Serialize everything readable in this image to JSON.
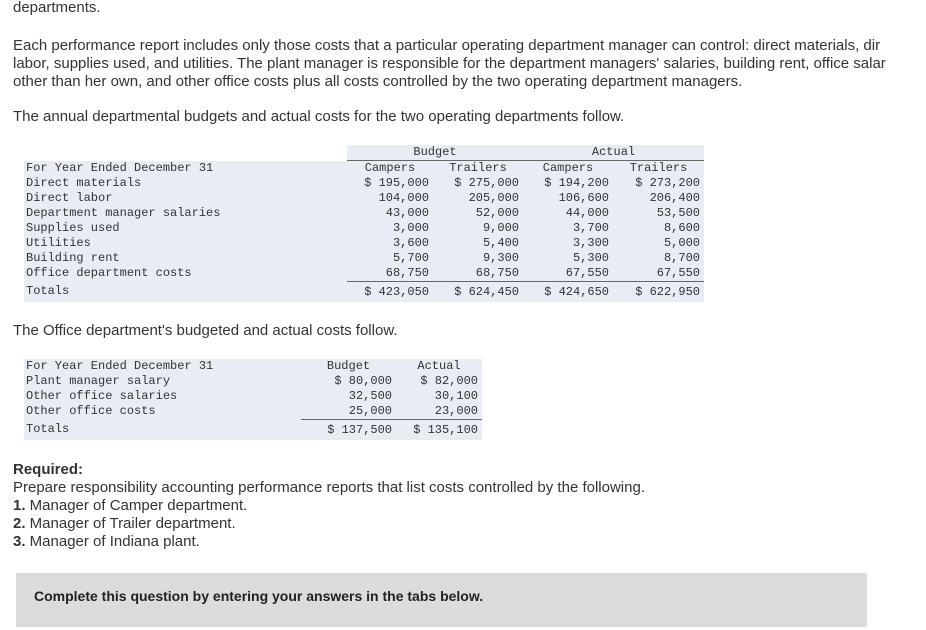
{
  "intro": {
    "line0": "departments.",
    "para1": [
      "Each performance report includes only those costs that a particular operating department manager can control: direct materials, dir",
      "labor, supplies used, and utilities. The plant manager is responsible for the department managers' salaries, building rent, office salar",
      "other than her own, and other office costs plus all costs controlled by the two operating department managers."
    ],
    "para2": "The annual departmental budgets and actual costs for the two operating departments follow."
  },
  "dept_table": {
    "group_budget": "Budget",
    "group_actual": "Actual",
    "row_header": "For Year Ended December 31",
    "columns": [
      "Campers",
      "Trailers",
      "Campers",
      "Trailers"
    ],
    "rows": [
      {
        "label": "Direct materials",
        "values": [
          "$ 195,000",
          "$ 275,000",
          "$ 194,200",
          "$ 273,200"
        ]
      },
      {
        "label": "Direct labor",
        "values": [
          "104,000",
          "205,000",
          "106,600",
          "206,400"
        ]
      },
      {
        "label": "Department manager salaries",
        "values": [
          "43,000",
          "52,000",
          "44,000",
          "53,500"
        ]
      },
      {
        "label": "Supplies used",
        "values": [
          "3,000",
          "9,000",
          "3,700",
          "8,600"
        ]
      },
      {
        "label": "Utilities",
        "values": [
          "3,600",
          "5,400",
          "3,300",
          "5,000"
        ]
      },
      {
        "label": "Building rent",
        "values": [
          "5,700",
          "9,300",
          "5,300",
          "8,700"
        ]
      },
      {
        "label": "Office department costs",
        "values": [
          "68,750",
          "68,750",
          "67,550",
          "67,550"
        ]
      }
    ],
    "totals": {
      "label": "Totals",
      "values": [
        "$ 423,050",
        "$ 624,450",
        "$ 424,650",
        "$ 622,950"
      ]
    }
  },
  "para3": "The Office department's budgeted and actual costs follow.",
  "office_table": {
    "row_header": "For Year Ended December 31",
    "columns": [
      "Budget",
      "Actual"
    ],
    "rows": [
      {
        "label": "Plant manager salary",
        "values": [
          "$ 80,000",
          "$ 82,000"
        ]
      },
      {
        "label": "Other office salaries",
        "values": [
          "32,500",
          "30,100"
        ]
      },
      {
        "label": "Other office costs",
        "values": [
          "25,000",
          "23,000"
        ]
      }
    ],
    "totals": {
      "label": "Totals",
      "values": [
        "$ 137,500",
        "$ 135,100"
      ]
    }
  },
  "required": {
    "title": "Required:",
    "text": "Prepare responsibility accounting performance reports that list costs controlled by the following.",
    "items": [
      {
        "num": "1.",
        "text": " Manager of Camper department."
      },
      {
        "num": "2.",
        "text": " Manager of Trailer department."
      },
      {
        "num": "3.",
        "text": " Manager of Indiana plant."
      }
    ]
  },
  "instruction_bar": {
    "text": "Complete this question by entering your answers in the tabs below."
  }
}
